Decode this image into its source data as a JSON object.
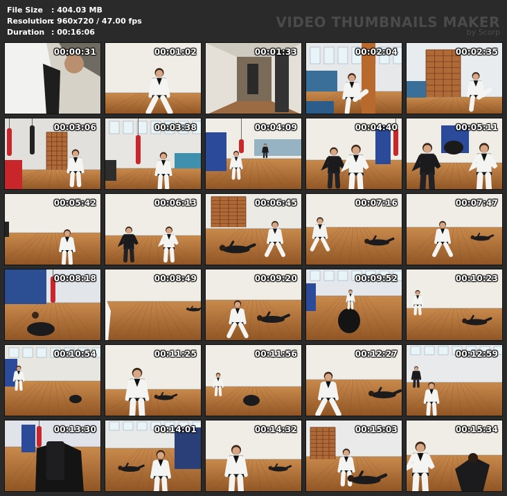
{
  "info": {
    "file_size_label": "File Size",
    "file_size_value": ": 404.03 MB",
    "resolution_label": "Resolution",
    "resolution_value": ": 960x720 / 47.00 fps",
    "duration_label": "Duration",
    "duration_value": ": 00:16:06"
  },
  "brand": {
    "title": "VIDEO THUMBNAILS MAKER",
    "subtitle": "by Scorp"
  },
  "colors": {
    "floor": "#b8763d",
    "wall": "#f0ede6",
    "mat_blue": "#2b4a9a",
    "bag_red": "#c8262a",
    "uniform": "#f4f4f2",
    "dark_clothing": "#1b1b1d",
    "belt": "#111111",
    "rib_wood": "#8a4e28"
  },
  "thumbnails": [
    {
      "time": "00:00:31",
      "scene": "closeup"
    },
    {
      "time": "00:01:02",
      "scene": "stance"
    },
    {
      "time": "00:01:33",
      "scene": "hallway"
    },
    {
      "time": "00:02:04",
      "scene": "gym-kick"
    },
    {
      "time": "00:02:35",
      "scene": "wall-kick"
    },
    {
      "time": "00:03:06",
      "scene": "bags-left"
    },
    {
      "time": "00:03:38",
      "scene": "bags-mid"
    },
    {
      "time": "00:04:09",
      "scene": "hall-wide"
    },
    {
      "time": "00:04:40",
      "scene": "pair-close"
    },
    {
      "time": "00:05:11",
      "scene": "pair-close2"
    },
    {
      "time": "00:05:42",
      "scene": "one-center"
    },
    {
      "time": "00:06:13",
      "scene": "two-spar"
    },
    {
      "time": "00:06:45",
      "scene": "floor-pin"
    },
    {
      "time": "00:07:16",
      "scene": "floor-pin2"
    },
    {
      "time": "00:07:47",
      "scene": "floor-pin3"
    },
    {
      "time": "00:08:18",
      "scene": "sit-bag"
    },
    {
      "time": "00:08:49",
      "scene": "empty-room"
    },
    {
      "time": "00:09:20",
      "scene": "takedown"
    },
    {
      "time": "00:09:52",
      "scene": "spin"
    },
    {
      "time": "00:10:23",
      "scene": "far-floor"
    },
    {
      "time": "00:10:54",
      "scene": "hall-corner"
    },
    {
      "time": "00:11:25",
      "scene": "back-view"
    },
    {
      "time": "00:11:56",
      "scene": "far-two"
    },
    {
      "time": "00:12:27",
      "scene": "standing-pin"
    },
    {
      "time": "00:12:59",
      "scene": "corner-two"
    },
    {
      "time": "00:13:30",
      "scene": "dark-close"
    },
    {
      "time": "00:14:01",
      "scene": "hall-fight"
    },
    {
      "time": "00:14:32",
      "scene": "pin-stand"
    },
    {
      "time": "00:15:03",
      "scene": "ground-stand"
    },
    {
      "time": "00:15:34",
      "scene": "close-two"
    }
  ]
}
